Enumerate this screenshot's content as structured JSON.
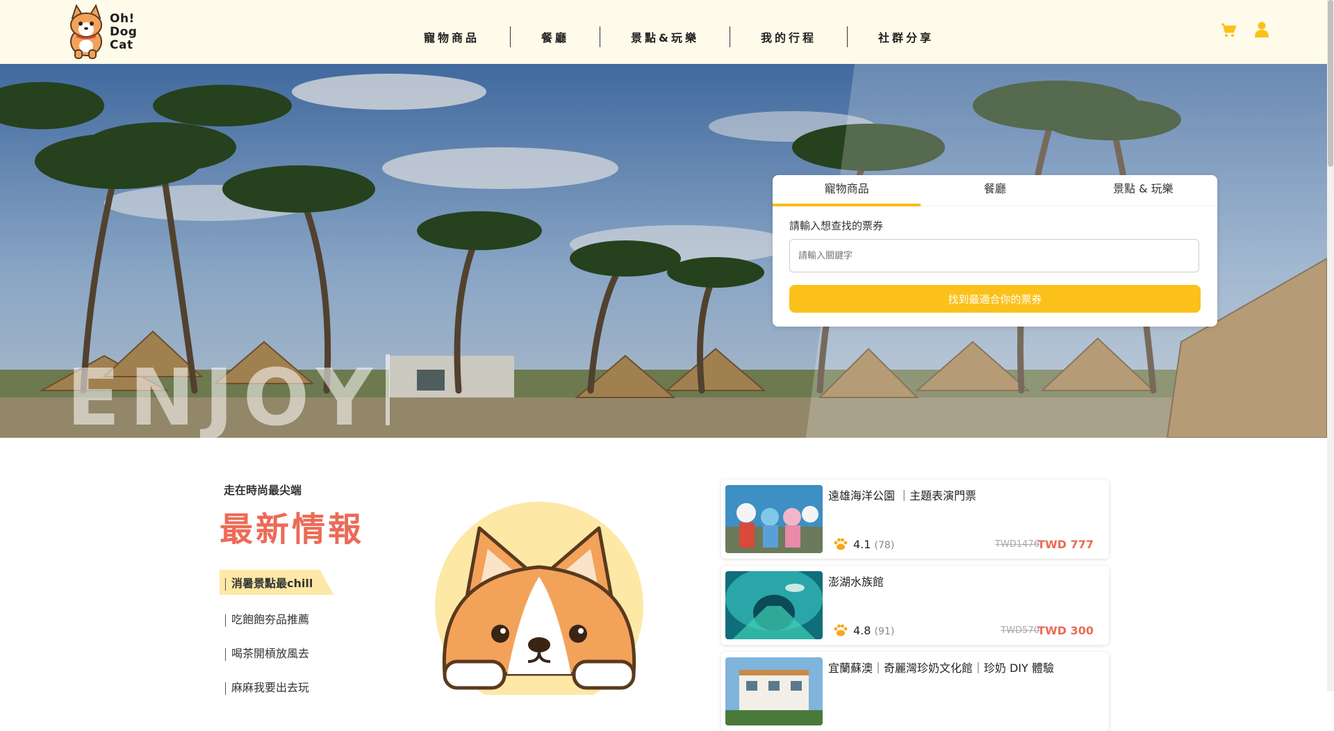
{
  "header": {
    "logo": {
      "line1": "Oh!",
      "line2": "Dog",
      "line3": "Cat"
    },
    "nav": [
      {
        "label": "寵物商品"
      },
      {
        "label": "餐廳"
      },
      {
        "label": "景點&玩樂"
      },
      {
        "label": "我的行程"
      },
      {
        "label": "社群分享"
      }
    ],
    "icons": {
      "cart": "cart-icon",
      "user": "user-icon",
      "accent": "#fbc11a"
    }
  },
  "hero": {
    "overlay_text": "ENJOY",
    "search": {
      "tabs": [
        {
          "label": "寵物商品",
          "active": true
        },
        {
          "label": "餐廳",
          "active": false
        },
        {
          "label": "景點 & 玩樂",
          "active": false
        }
      ],
      "label": "請輸入想查找的票券",
      "placeholder": "請輸入關鍵字",
      "button": "找到最適合你的票券",
      "accent": "#fbc11a"
    }
  },
  "news": {
    "subtitle": "走在時尚最尖端",
    "title": "最新情報",
    "title_color": "#ec6b57",
    "items": [
      {
        "label": "消暑景點最chill",
        "active": true
      },
      {
        "label": "吃飽飽夯品推薦",
        "active": false
      },
      {
        "label": "喝茶開槓放風去",
        "active": false
      },
      {
        "label": "麻麻我要出去玩",
        "active": false
      }
    ]
  },
  "products": [
    {
      "title": "遠雄海洋公園 ｜主題表演門票",
      "rating": "4.1",
      "count": "(78)",
      "old_price": "TWD1476",
      "price": "TWD 777"
    },
    {
      "title": "澎湖水族館",
      "rating": "4.8",
      "count": "(91)",
      "old_price": "TWD570",
      "price": "TWD 300"
    },
    {
      "title": "宜蘭蘇澳｜奇麗灣珍奶文化館｜珍奶 DIY 體驗",
      "rating": "",
      "count": "",
      "old_price": "",
      "price": ""
    }
  ]
}
